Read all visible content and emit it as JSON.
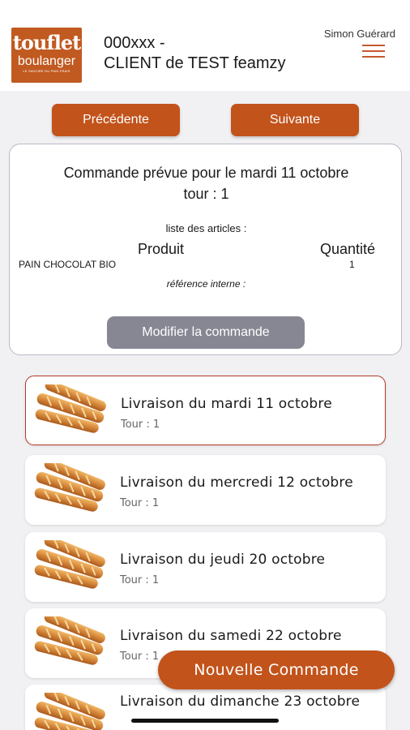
{
  "header": {
    "logo_top": "touflet",
    "logo_bottom": "boulanger",
    "logo_tagline": "LE SAVOIRE DU PAIN FRAIS",
    "client_code": "000xxx -",
    "client_name": "CLIENT de TEST feamzy",
    "user_name": "Simon Guérard",
    "menu_icon": "hamburger-menu-icon"
  },
  "nav": {
    "prev_label": "Précédente",
    "next_label": "Suivante"
  },
  "order": {
    "title_line1": "Commande prévue pour le mardi 11 octobre",
    "title_line2": "tour : 1",
    "articles_label": "liste des articles :",
    "col_product": "Produit",
    "col_quantity": "Quantité",
    "items": [
      {
        "name": "PAIN CHOCOLAT BIO",
        "quantity": "1"
      }
    ],
    "reference_label": "référence interne :",
    "modify_label": "Modifier la commande"
  },
  "deliveries": [
    {
      "title": "Livraison du mardi 11 octobre",
      "tour": "Tour : 1",
      "selected": true
    },
    {
      "title": "Livraison du mercredi 12 octobre",
      "tour": "Tour : 1",
      "selected": false
    },
    {
      "title": "Livraison du jeudi 20 octobre",
      "tour": "Tour : 1",
      "selected": false
    },
    {
      "title": "Livraison du samedi 22 octobre",
      "tour": "Tour : 1",
      "selected": false
    },
    {
      "title": "Livraison du dimanche 23 octobre",
      "tour": "",
      "selected": false
    }
  ],
  "fab_label": "Nouvelle Commande",
  "colors": {
    "brand": "#c2531b",
    "secondary_button": "#868793",
    "selected_border": "#b63a26",
    "background": "#f1f1f3"
  }
}
